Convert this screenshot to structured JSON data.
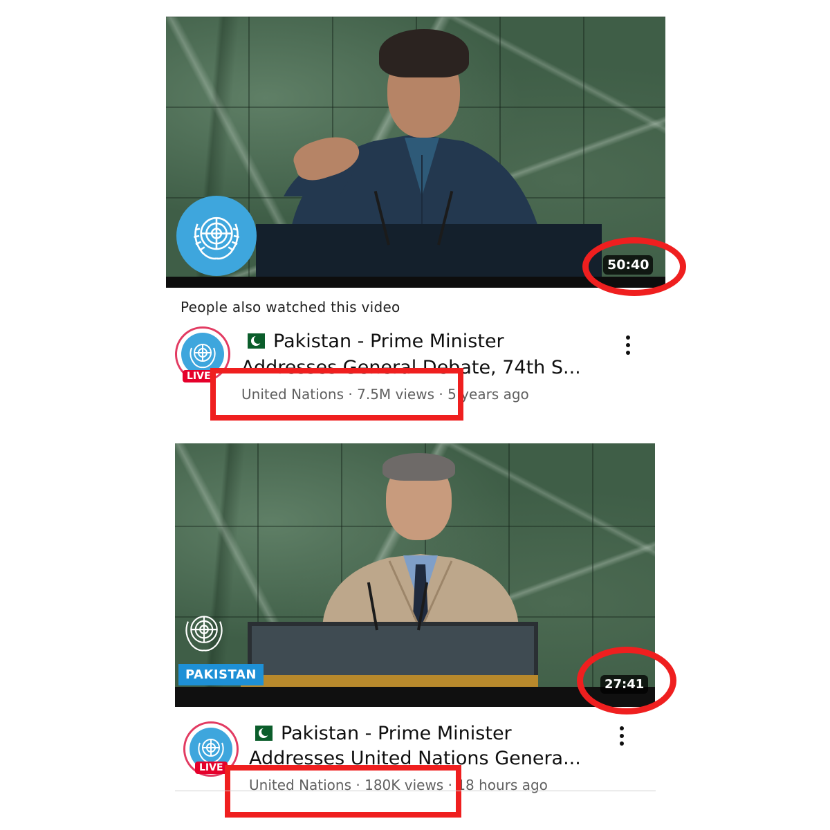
{
  "videos": [
    {
      "duration": "50:40",
      "title_line1": "Pakistan - Prime Minister",
      "title_line2": "Addresses General Debate, 74th S...",
      "channel": "United Nations",
      "views": "7.5M views",
      "age": "5 years ago",
      "live_label": "LIVE"
    },
    {
      "duration": "27:41",
      "country_tag": "PAKISTAN",
      "title_line1": "Pakistan - Prime Minister",
      "title_line2": "Addresses United Nations Genera...",
      "channel": "United Nations",
      "views": "180K views",
      "age": "18 hours ago",
      "live_label": "LIVE"
    }
  ],
  "section_label": "People also watched this video",
  "separator": "·",
  "colors": {
    "highlight": "#ef1f1f",
    "un_blue": "#3ea6dd",
    "live_red": "#e5002b"
  },
  "icons": [
    "un-emblem-icon",
    "pakistan-flag-icon",
    "more-vert-icon"
  ]
}
